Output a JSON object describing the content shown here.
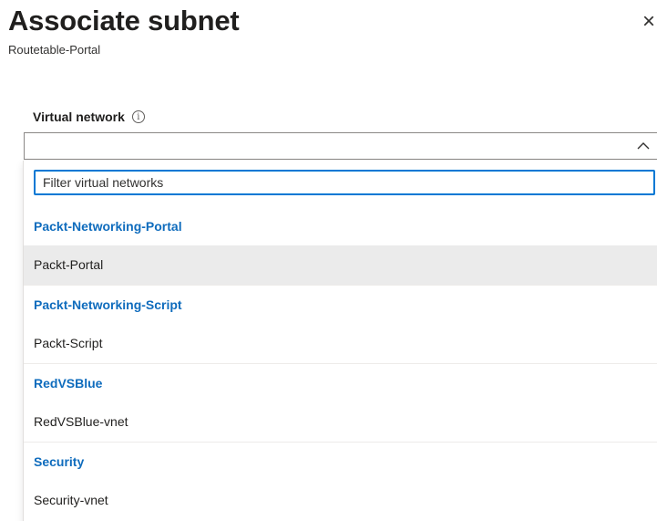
{
  "panel": {
    "title": "Associate subnet",
    "subtitle": "Routetable-Portal",
    "close_glyph": "×"
  },
  "field": {
    "label": "Virtual network",
    "info_icon_glyph": "i",
    "value": ""
  },
  "filter": {
    "placeholder": "Filter virtual networks",
    "value": ""
  },
  "groups": [
    {
      "name": "Packt-Networking-Portal",
      "items": [
        "Packt-Portal"
      ]
    },
    {
      "name": "Packt-Networking-Script",
      "items": [
        "Packt-Script"
      ]
    },
    {
      "name": "RedVSBlue",
      "items": [
        "RedVSBlue-vnet"
      ]
    },
    {
      "name": "Security",
      "items": [
        "Security-vnet"
      ]
    }
  ],
  "highlighted_item": "Packt-Portal",
  "colors": {
    "group_header": "#0f6cbd",
    "focus_border": "#0078d4",
    "highlight_bg": "#ebebeb"
  },
  "icons": {
    "close": "close-icon",
    "info": "info-icon",
    "chevron": "chevron-up-icon"
  }
}
